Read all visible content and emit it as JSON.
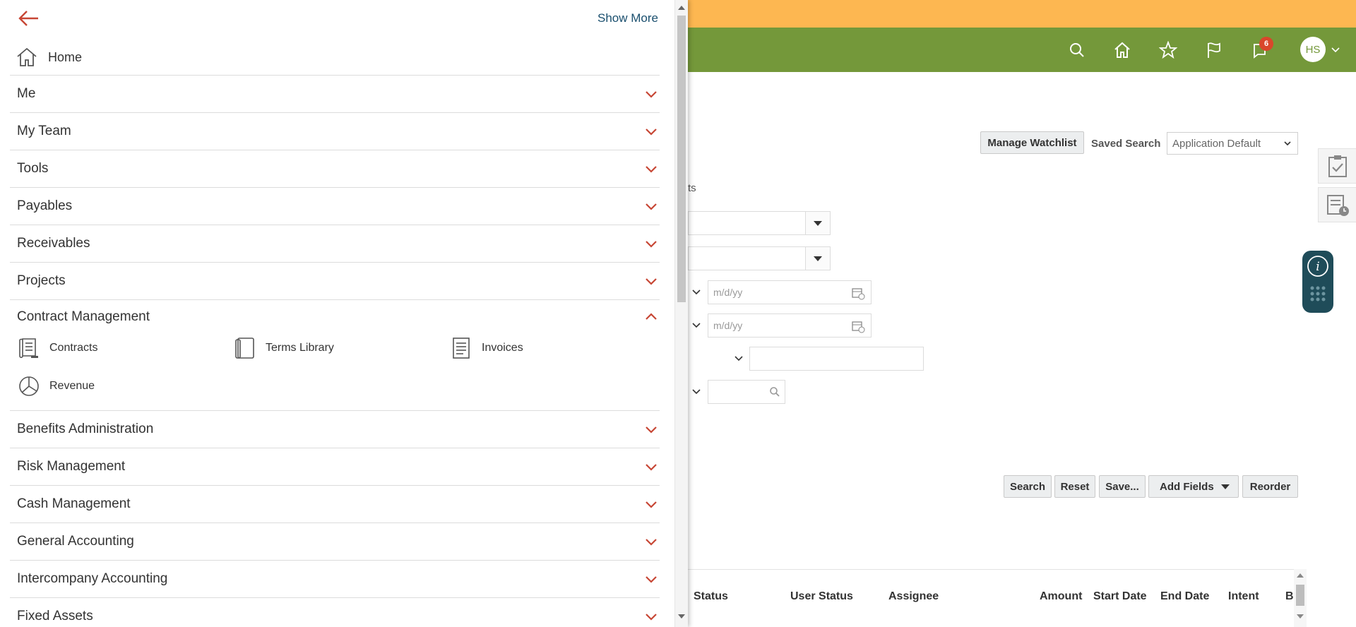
{
  "header": {
    "notification_count": "6",
    "avatar_initials": "HS",
    "icons": [
      "search-icon",
      "home-icon",
      "star-icon",
      "flag-icon",
      "notifications-icon"
    ]
  },
  "search_panel": {
    "manage_watchlist": "Manage Watchlist",
    "saved_search_label": "Saved Search",
    "saved_search_value": "Application Default",
    "partial_label": "ts",
    "date_placeholder": "m/d/yy",
    "buttons": {
      "search": "Search",
      "reset": "Reset",
      "save": "Save...",
      "add_fields": "Add Fields",
      "reorder": "Reorder"
    }
  },
  "results_table": {
    "columns": [
      "Status",
      "User Status",
      "Assignee",
      "Amount",
      "Start Date",
      "End Date",
      "Intent",
      "B"
    ]
  },
  "navigator": {
    "show_more": "Show More",
    "home": "Home",
    "items": [
      {
        "label": "Me",
        "expanded": false
      },
      {
        "label": "My Team",
        "expanded": false
      },
      {
        "label": "Tools",
        "expanded": false
      },
      {
        "label": "Payables",
        "expanded": false
      },
      {
        "label": "Receivables",
        "expanded": false
      },
      {
        "label": "Projects",
        "expanded": false
      },
      {
        "label": "Contract Management",
        "expanded": true
      },
      {
        "label": "Benefits Administration",
        "expanded": false
      },
      {
        "label": "Risk Management",
        "expanded": false
      },
      {
        "label": "Cash Management",
        "expanded": false
      },
      {
        "label": "General Accounting",
        "expanded": false
      },
      {
        "label": "Intercompany Accounting",
        "expanded": false
      },
      {
        "label": "Fixed Assets",
        "expanded": false
      }
    ],
    "contract_management_children": [
      {
        "label": "Contracts",
        "icon": "contracts-scroll-icon"
      },
      {
        "label": "Terms Library",
        "icon": "terms-library-book-icon"
      },
      {
        "label": "Invoices",
        "icon": "invoice-document-icon"
      },
      {
        "label": "Revenue",
        "icon": "revenue-pie-chart-icon"
      }
    ]
  },
  "colors": {
    "top_strip": "#fdb751",
    "header_green": "#74983a",
    "accent_orange": "#c74634",
    "badge_red": "#d9472b",
    "info_pill": "#1f4c59"
  }
}
